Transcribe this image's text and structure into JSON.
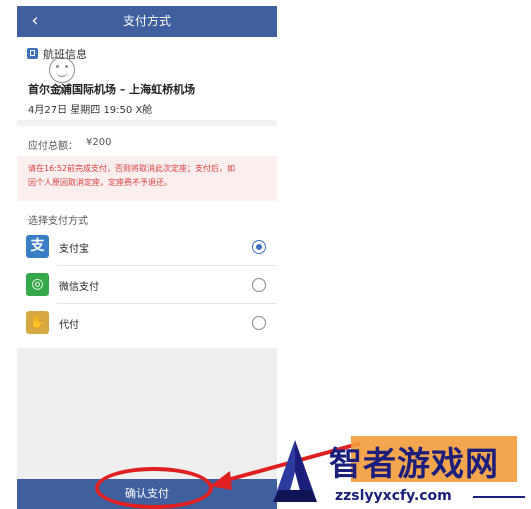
{
  "nav": {
    "back_icon": "‹",
    "title": "支付方式"
  },
  "flight": {
    "header": "航班信息",
    "route": "首尔金浦国际机场 – 上海虹桥机场",
    "time": "4月27日 星期四 19:50 X舱",
    "cursor_glyph": "X"
  },
  "total": {
    "label": "应付总额：",
    "amount": "¥200"
  },
  "notice": {
    "line1": "请在16:52前完成支付，否则将取消此次定座；支付后，如",
    "line2": "因个人原因取消定座，定座费不予退还。"
  },
  "payment": {
    "header": "选择支付方式",
    "methods": [
      {
        "label": "支付宝",
        "icon": "alipay-icon",
        "color": "#3a7fc5",
        "glyph": "支",
        "selected": true
      },
      {
        "label": "微信支付",
        "icon": "wechat-pay-icon",
        "color": "#35a84a",
        "glyph": "◎",
        "selected": false
      },
      {
        "label": "代付",
        "icon": "proxy-pay-icon",
        "color": "#d6a842",
        "glyph": "✋",
        "selected": false
      }
    ]
  },
  "confirm": {
    "label": "确认支付"
  },
  "watermark": {
    "title": "智者游戏网",
    "domain": "zzslyyxcfy.com"
  },
  "colors": {
    "nav": "#3f5f9f",
    "accent": "#3f6fc2",
    "annotation": "#e02020"
  }
}
